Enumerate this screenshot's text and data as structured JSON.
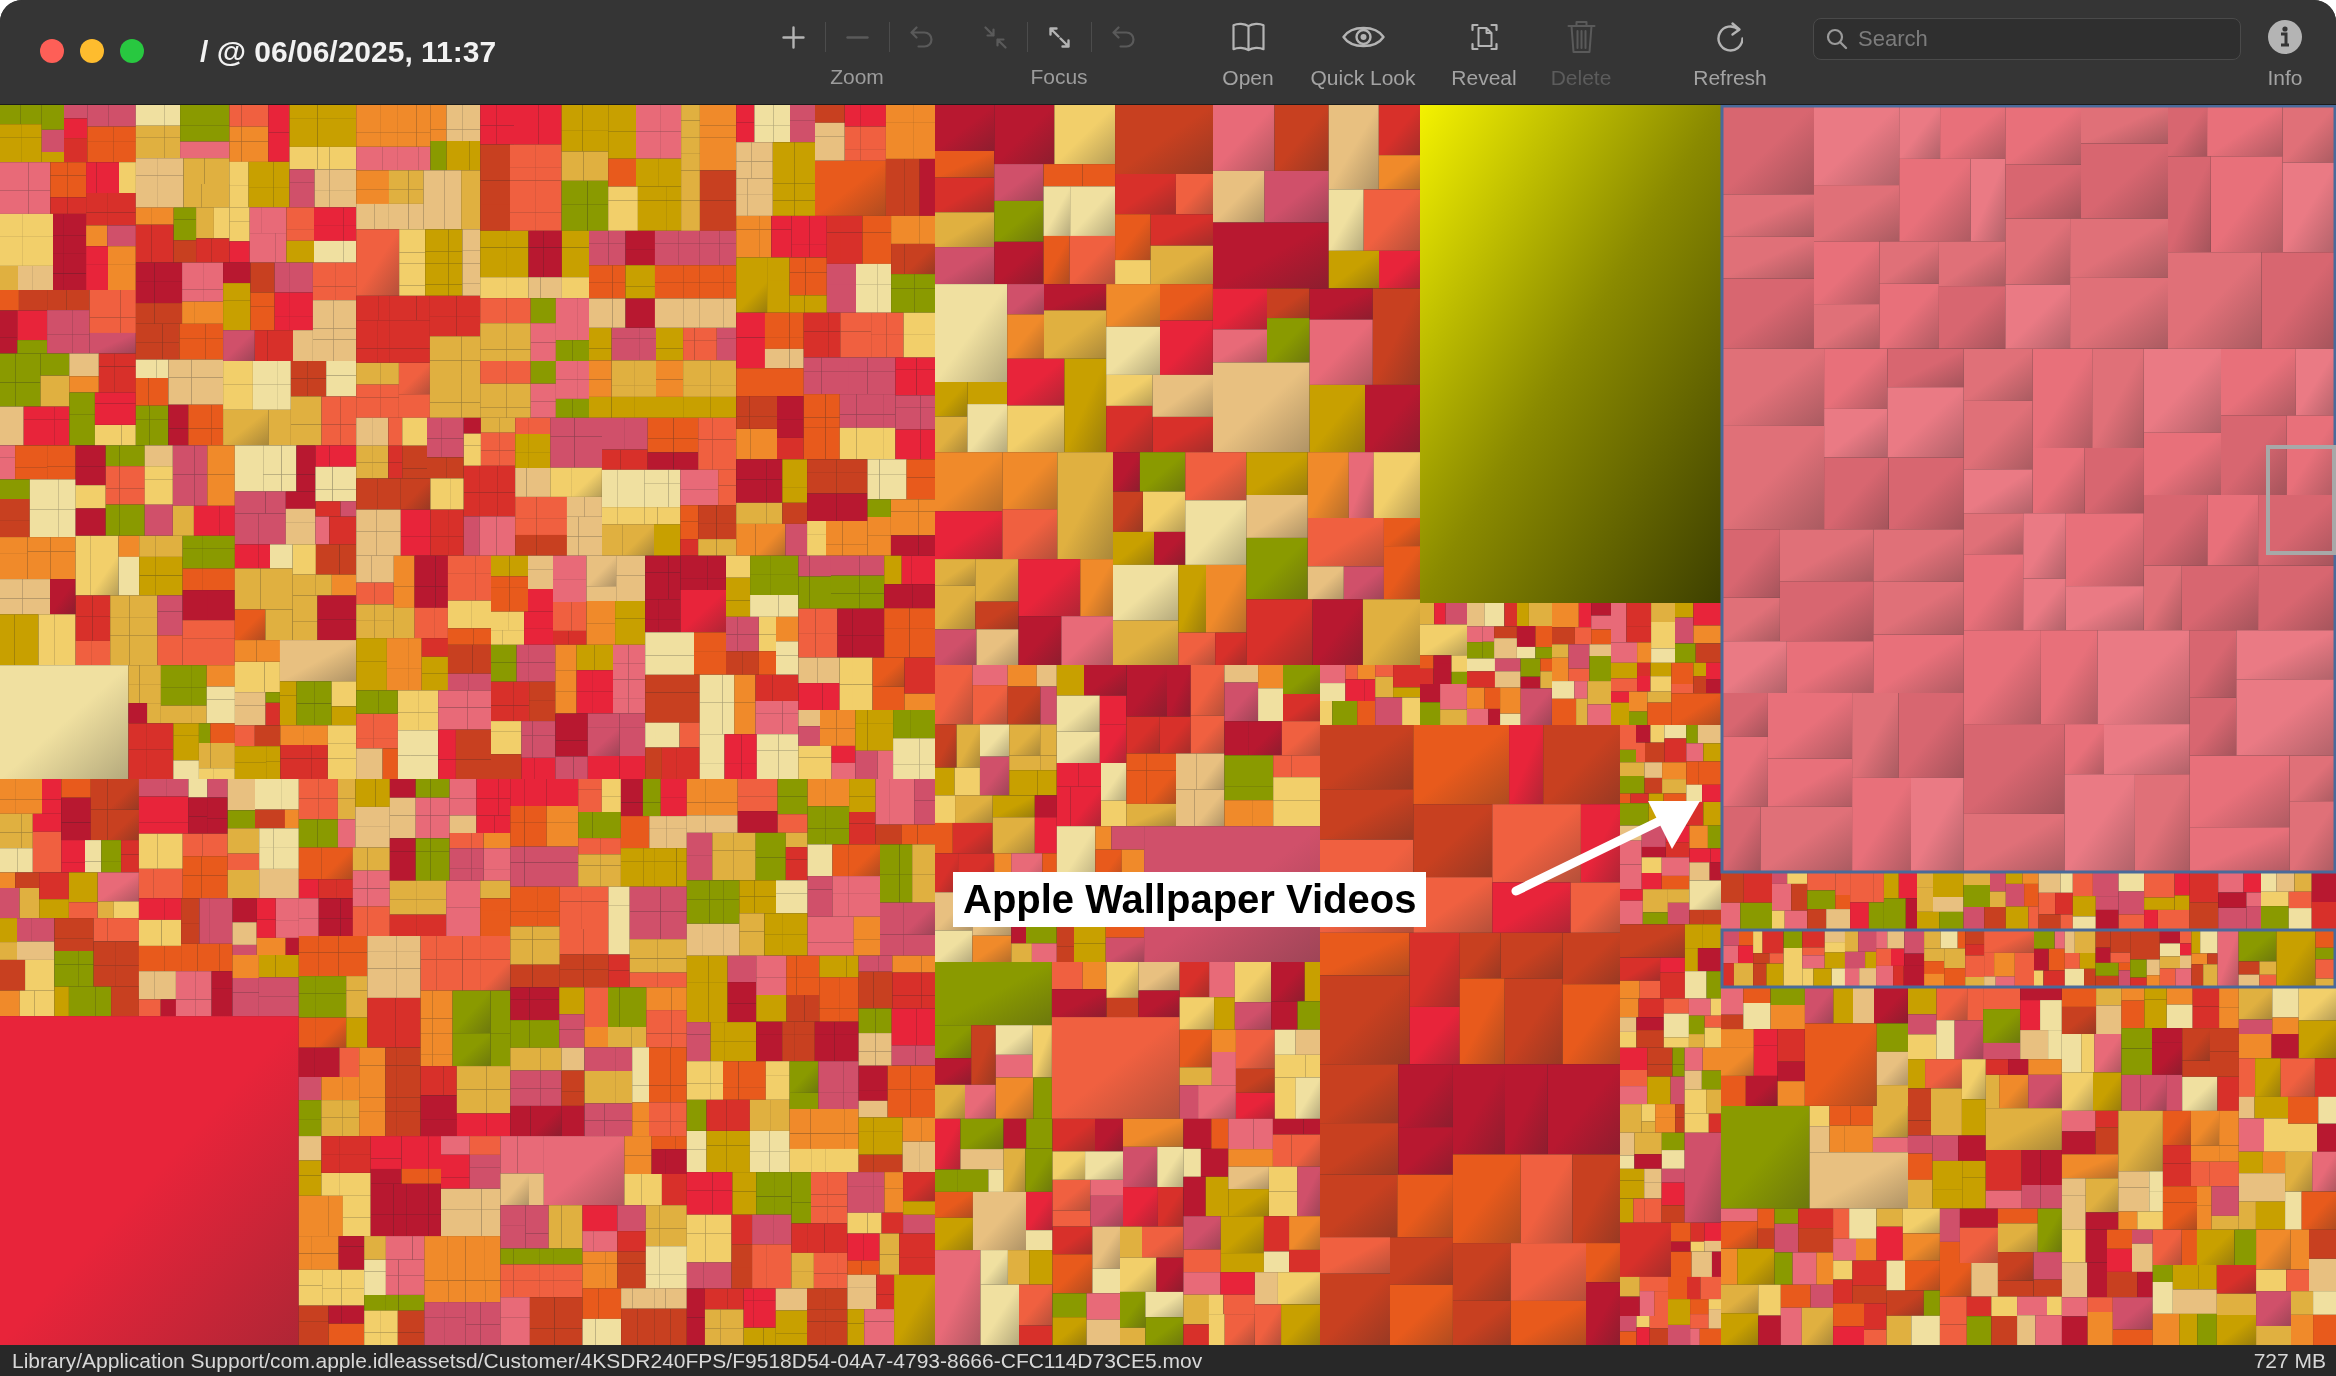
{
  "window": {
    "title": "/ @ 06/06/2025, 11:37"
  },
  "toolbar": {
    "zoom": {
      "label": "Zoom",
      "buttons": [
        {
          "kind": "plus",
          "disabled": false
        },
        {
          "kind": "minus",
          "disabled": true
        },
        {
          "kind": "back",
          "disabled": true
        }
      ]
    },
    "focus": {
      "label": "Focus",
      "buttons": [
        {
          "kind": "shrink",
          "disabled": true
        },
        {
          "kind": "expand",
          "disabled": false
        },
        {
          "kind": "back",
          "disabled": true
        }
      ]
    },
    "actions": [
      {
        "kind": "book",
        "label": "Open",
        "disabled": false
      },
      {
        "kind": "eye",
        "label": "Quick Look",
        "disabled": false
      },
      {
        "kind": "reveal",
        "label": "Reveal",
        "disabled": false
      },
      {
        "kind": "trash",
        "label": "Delete",
        "disabled": true
      },
      {
        "kind": "refresh",
        "label": "Refresh",
        "disabled": false
      }
    ],
    "search": {
      "placeholder": "Search"
    },
    "info": {
      "label": "Info"
    }
  },
  "treemap": {
    "annotation": {
      "label": "Apple Wallpaper Videos"
    }
  },
  "status_bar": {
    "path": "Library/Application Support/com.apple.idleassetsd/Customer/4KSDR240FPS/F9518D54-04A7-4793-8666-CFC114D73CE5.mov",
    "size": "727 MB"
  }
}
